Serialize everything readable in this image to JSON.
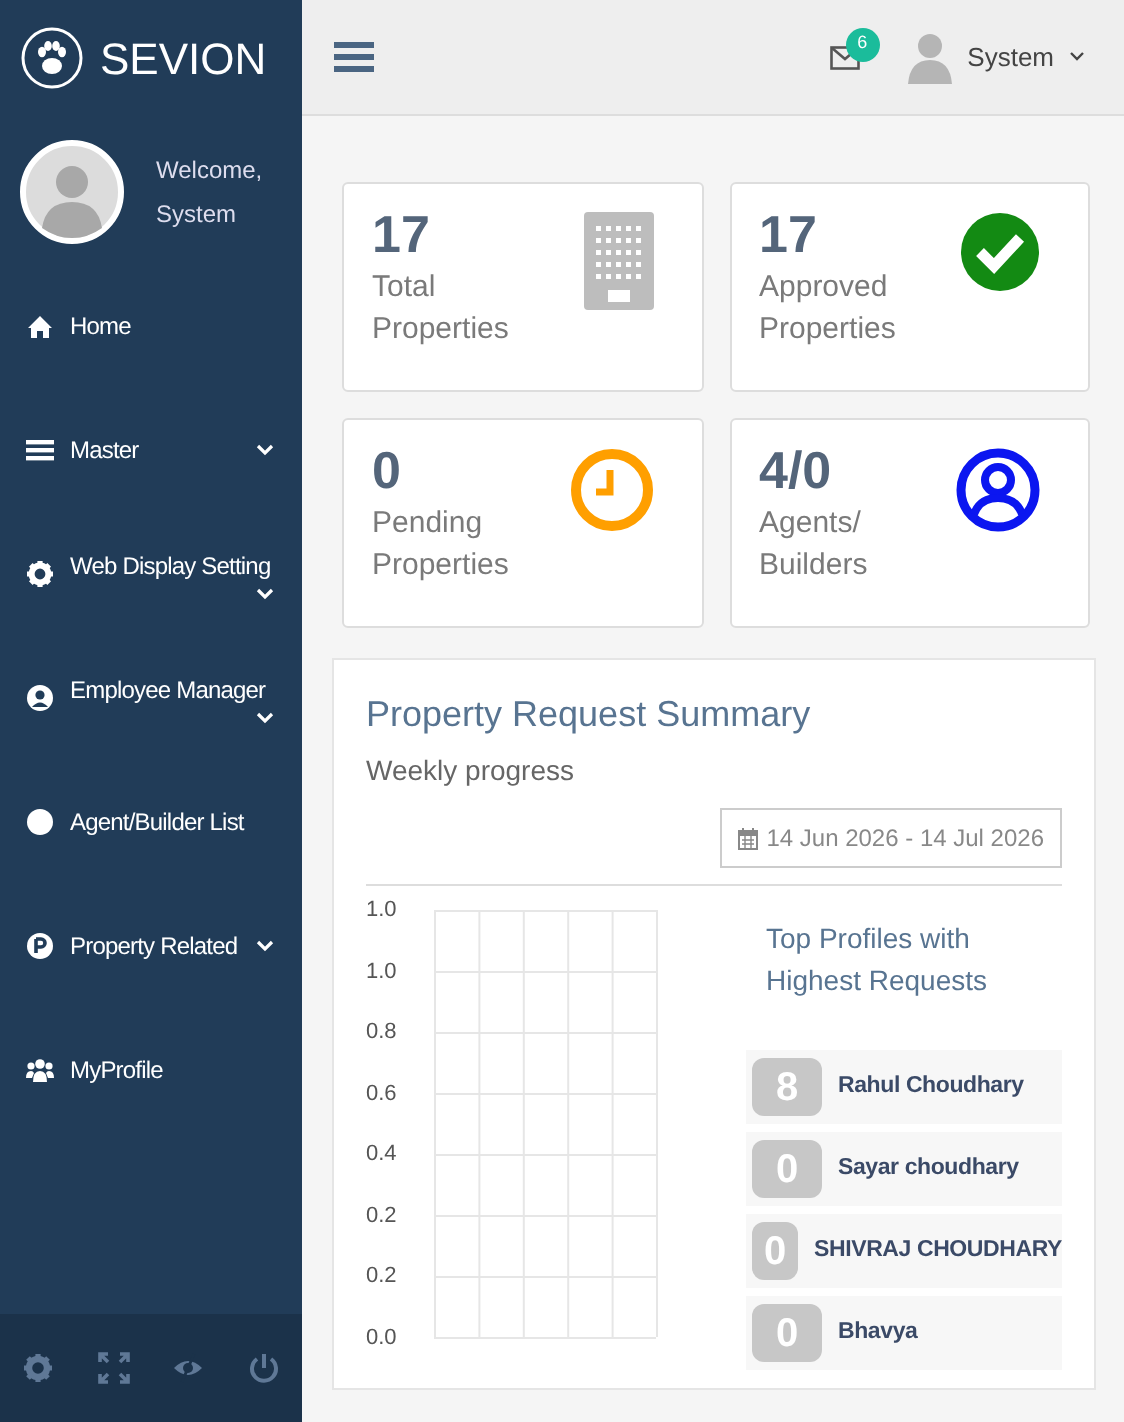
{
  "brand": "SEVION",
  "user": {
    "greeting": "Welcome,",
    "name": "System"
  },
  "nav": [
    {
      "label": "Home",
      "expandable": false
    },
    {
      "label": "Master",
      "expandable": true
    },
    {
      "label": "Web Display Setting",
      "expandable": true
    },
    {
      "label": "Employee Manager",
      "expandable": true
    },
    {
      "label": "Agent/Builder List",
      "expandable": false
    },
    {
      "label": "Property Related",
      "expandable": true
    },
    {
      "label": "MyProfile",
      "expandable": false
    }
  ],
  "topbar": {
    "mail_count": "6",
    "user": "System"
  },
  "stats": [
    {
      "value": "17",
      "label": "Total Properties",
      "color": "#bdbdbd"
    },
    {
      "value": "17",
      "label": "Approved Properties",
      "color": "#138a13"
    },
    {
      "value": "0",
      "label": "Pending Properties",
      "color": "#ff9f00"
    },
    {
      "value": "4/0",
      "label": "Agents/ Builders",
      "color": "#0b16f0"
    }
  ],
  "summary": {
    "title": "Property Request Summary",
    "subtitle": "Weekly progress",
    "date_range": "14 Jun 2026 - 14 Jul 2026",
    "chart": {
      "y_labels": [
        "1.0",
        "1.0",
        "0.8",
        "0.6",
        "0.4",
        "0.2",
        "0.2",
        "0.0"
      ]
    },
    "top_title": "Top Profiles with Highest Requests",
    "top_profiles": [
      {
        "count": "8",
        "name": "Rahul Choudhary"
      },
      {
        "count": "0",
        "name": "Sayar choudhary"
      },
      {
        "count": "0",
        "name": "SHIVRAJ CHOUDHARY"
      },
      {
        "count": "0",
        "name": "Bhavya"
      }
    ]
  }
}
